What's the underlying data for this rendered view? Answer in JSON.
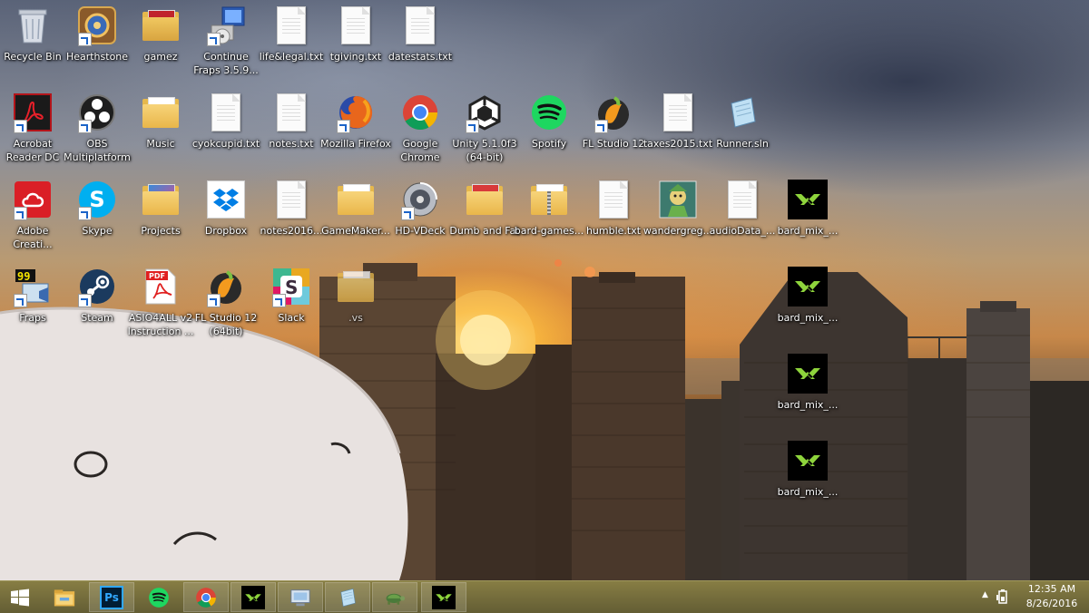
{
  "desktop": {
    "icons": [
      {
        "label": "Recycle Bin",
        "icon": "recycle-bin-icon"
      },
      {
        "label": "Hearthstone",
        "icon": "hearthstone-icon"
      },
      {
        "label": "gamez",
        "icon": "folder-icon"
      },
      {
        "label": "Continue Fraps 3.5.9...",
        "icon": "installer-icon"
      },
      {
        "label": "life&legal.txt",
        "icon": "text-file-icon"
      },
      {
        "label": "tgiving.txt",
        "icon": "text-file-icon"
      },
      {
        "label": "datestats.txt",
        "icon": "text-file-icon"
      },
      {
        "label": "Acrobat Reader DC",
        "icon": "acrobat-icon"
      },
      {
        "label": "OBS Multiplatform",
        "icon": "obs-icon"
      },
      {
        "label": "Music",
        "icon": "folder-icon"
      },
      {
        "label": "cyokcupid.txt",
        "icon": "text-file-icon"
      },
      {
        "label": "notes.txt",
        "icon": "text-file-icon"
      },
      {
        "label": "Mozilla Firefox",
        "icon": "firefox-icon"
      },
      {
        "label": "Google Chrome",
        "icon": "chrome-icon"
      },
      {
        "label": "Unity 5.1.0f3 (64-bit)",
        "icon": "unity-icon"
      },
      {
        "label": "Spotify",
        "icon": "spotify-icon"
      },
      {
        "label": "FL Studio 12",
        "icon": "fl-studio-icon"
      },
      {
        "label": "taxes2015.txt",
        "icon": "text-file-icon"
      },
      {
        "label": "Runner.sln",
        "icon": "solution-file-icon"
      },
      {
        "label": "Adobe Creati...",
        "icon": "creative-cloud-icon"
      },
      {
        "label": "Skype",
        "icon": "skype-icon"
      },
      {
        "label": "Projects",
        "icon": "folder-icon"
      },
      {
        "label": "Dropbox",
        "icon": "dropbox-icon"
      },
      {
        "label": "notes2016...",
        "icon": "text-file-icon"
      },
      {
        "label": "GameMaker...",
        "icon": "folder-icon"
      },
      {
        "label": "HD-VDeck",
        "icon": "hd-vdeck-icon"
      },
      {
        "label": "Dumb and Fat",
        "icon": "folder-icon"
      },
      {
        "label": "bard-games...",
        "icon": "zip-folder-icon"
      },
      {
        "label": "humble.txt",
        "icon": "text-file-icon"
      },
      {
        "label": "wandergreg...",
        "icon": "image-file-icon"
      },
      {
        "label": "audioData_...",
        "icon": "text-file-icon"
      },
      {
        "label": "bard_mix_...",
        "icon": "gamemaker-icon"
      },
      {
        "label": "Fraps",
        "icon": "fraps-icon"
      },
      {
        "label": "Steam",
        "icon": "steam-icon"
      },
      {
        "label": "ASIO4ALL v2 Instruction ...",
        "icon": "pdf-icon"
      },
      {
        "label": "FL Studio 12 (64bit)",
        "icon": "fl-studio-icon"
      },
      {
        "label": "Slack",
        "icon": "slack-icon"
      },
      {
        "label": ".vs",
        "icon": "folder-icon"
      },
      {
        "label": "bard_mix_...",
        "icon": "gamemaker-icon"
      },
      {
        "label": "bard_mix_...",
        "icon": "gamemaker-icon"
      },
      {
        "label": "bard_mix_...",
        "icon": "gamemaker-icon"
      }
    ]
  },
  "taskbar": {
    "buttons": [
      {
        "icon": "windows-start-icon"
      },
      {
        "icon": "file-explorer-icon"
      },
      {
        "icon": "photoshop-icon",
        "text": "Ps"
      },
      {
        "icon": "spotify-icon"
      },
      {
        "icon": "chrome-icon"
      },
      {
        "icon": "gamemaker-icon"
      },
      {
        "icon": "control-panel-icon"
      },
      {
        "icon": "notepad-icon"
      },
      {
        "icon": "turtle-icon"
      },
      {
        "icon": "gamemaker-icon"
      }
    ],
    "tray": {
      "time": "12:35 AM",
      "date": "8/26/2016"
    }
  }
}
